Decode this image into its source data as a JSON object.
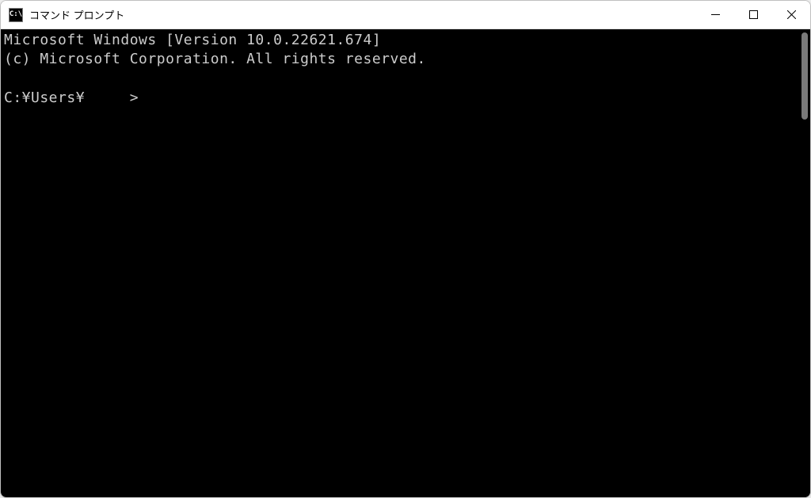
{
  "window": {
    "title": "コマンド プロンプト",
    "icon_label": "C:\\"
  },
  "terminal": {
    "line1": "Microsoft Windows [Version 10.0.22621.674]",
    "line2": "(c) Microsoft Corporation. All rights reserved.",
    "prompt": "C:¥Users¥     >"
  }
}
